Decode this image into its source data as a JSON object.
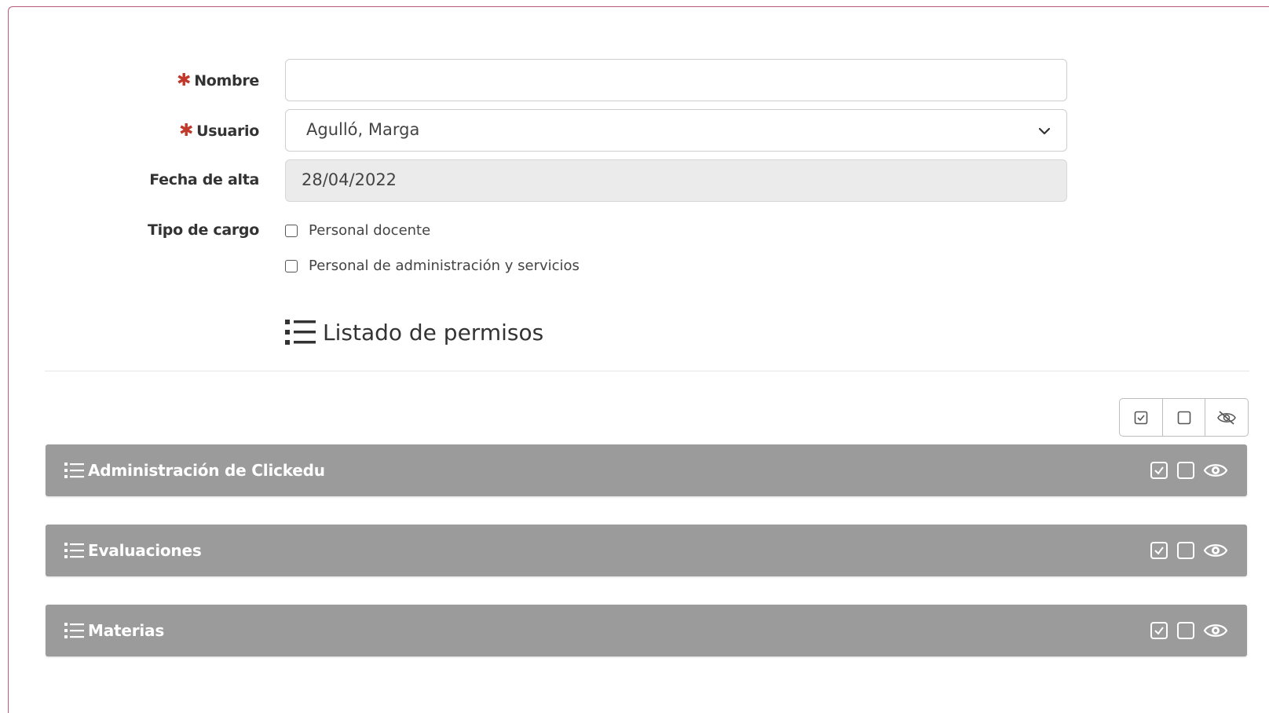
{
  "form": {
    "nombre": {
      "label": "Nombre",
      "value": "",
      "required": true
    },
    "usuario": {
      "label": "Usuario",
      "value": "Agulló, Marga",
      "required": true
    },
    "fecha_alta": {
      "label": "Fecha de alta",
      "value": "28/04/2022"
    },
    "tipo_cargo": {
      "label": "Tipo de cargo",
      "options": [
        "Personal docente",
        "Personal de administración y servicios"
      ]
    }
  },
  "permissions": {
    "title": "Listado de permisos",
    "toolbar_icons": [
      "check-all-icon",
      "uncheck-all-icon",
      "hide-all-icon"
    ],
    "sections": [
      {
        "title": "Administración de Clickedu"
      },
      {
        "title": "Evaluaciones"
      },
      {
        "title": "Materias"
      }
    ]
  },
  "colors": {
    "required_marker": "#c0392b",
    "panel_header": "#9b9b9b",
    "frame_border": "#b85a78"
  }
}
